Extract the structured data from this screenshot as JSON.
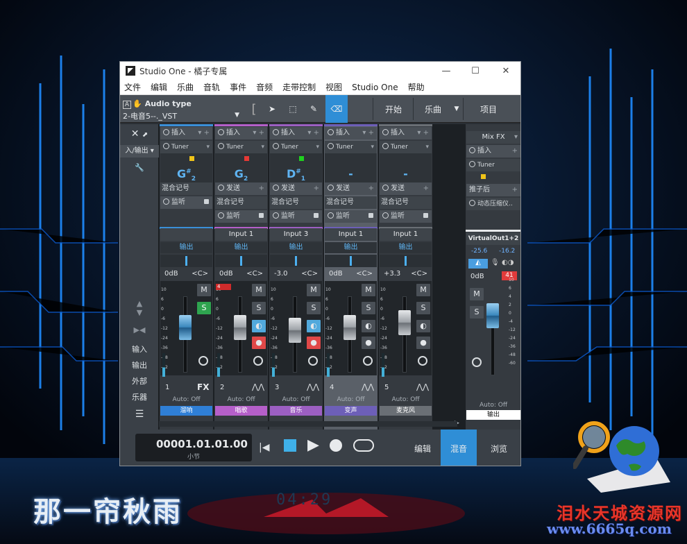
{
  "background": {
    "caption": "那一帘秋雨",
    "watermark_title": "泪水天城资源网",
    "watermark_url": "www.6665q.com",
    "clock_glow": "04:29"
  },
  "window": {
    "title": "Studio One - 橘子专属",
    "controls": {
      "minimize": "—",
      "maximize": "☐",
      "close": "✕"
    }
  },
  "menu": [
    "文件",
    "编辑",
    "乐曲",
    "音轨",
    "事件",
    "音频",
    "走带控制",
    "视图",
    "Studio One",
    "帮助"
  ],
  "toolbar": {
    "a_badge": "A",
    "audio_type": "Audio type",
    "preset": "2-电音5--._VST",
    "start": "开始",
    "song": "乐曲",
    "project": "项目"
  },
  "left_panel": {
    "input_label": "入/输出",
    "items": [
      "输入",
      "输出",
      "外部",
      "乐器"
    ]
  },
  "labels": {
    "insert": "插入",
    "tuner": "Tuner",
    "send": "发送",
    "mix_marker": "混合记号",
    "monitor": "监听",
    "output": "输出",
    "center": "<C>",
    "mute": "M",
    "solo": "S",
    "auto": "Auto: Off",
    "fx": "FX"
  },
  "channels": [
    {
      "name": "",
      "note": "G",
      "accidental": "#",
      "octave": "2",
      "mark_color": "#f0c419",
      "gain": "0dB",
      "num": "1",
      "bottom": "溜响",
      "bottom_color": "#2f7fd6",
      "top_color": "#3a8fd8",
      "fader": 0.62,
      "selected": false,
      "solo_on": true,
      "peak": ""
    },
    {
      "name": "Input 1",
      "note": "G",
      "accidental": "",
      "octave": "2",
      "mark_color": "#e53935",
      "gain": "0dB",
      "num": "2",
      "bottom": "唱歌",
      "bottom_color": "#b55fc9",
      "top_color": "#b55fc9",
      "fader": 0.62,
      "selected": false,
      "solo_on": false,
      "peak": "4"
    },
    {
      "name": "Input 3",
      "note": "D",
      "accidental": "#",
      "octave": "1",
      "mark_color": "#1fd11f",
      "gain": "-3.0",
      "num": "3",
      "bottom": "音乐",
      "bottom_color": "#9c5fc2",
      "top_color": "#9c5fc2",
      "fader": 0.55,
      "selected": false,
      "solo_on": false,
      "peak": ""
    },
    {
      "name": "Input 1",
      "note": "-",
      "accidental": "",
      "octave": "",
      "mark_color": "",
      "gain": "0dB",
      "num": "4",
      "bottom": "变声",
      "bottom_color": "#6d5fb8",
      "top_color": "#6d5fb8",
      "fader": 0.62,
      "selected": true,
      "solo_on": false,
      "peak": ""
    },
    {
      "name": "Input 1",
      "note": "-",
      "accidental": "",
      "octave": "",
      "mark_color": "",
      "gain": "+3.3",
      "num": "5",
      "bottom": "麦克风",
      "bottom_color": "#6a6f75",
      "top_color": "#6a6f75",
      "fader": 0.72,
      "selected": false,
      "solo_on": false,
      "peak": ""
    }
  ],
  "scale_ticks": [
    "10",
    "6",
    "0",
    "-6",
    "-12",
    "-24",
    "-36",
    "-48",
    "-72"
  ],
  "scale_ticks_out": [
    "10",
    "6",
    "4",
    "2",
    "0",
    "-4",
    "-12",
    "-24",
    "-36",
    "-48",
    "-60"
  ],
  "mixfx": {
    "title": "Mix FX",
    "insert": "插入",
    "tuner": "Tuner",
    "post": "推子后",
    "preset": "动态压缩仪..",
    "out_name": "VirtualOut1+2",
    "peak_l": "-25.6",
    "peak_r": "-16.2",
    "gain": "0dB",
    "clip": "41",
    "auto": "Auto: Off",
    "bottom": "输出"
  },
  "transport": {
    "time": "00001.01.01.00",
    "unit": "小节",
    "edit": "编辑",
    "mix": "混音",
    "browse": "浏览"
  }
}
